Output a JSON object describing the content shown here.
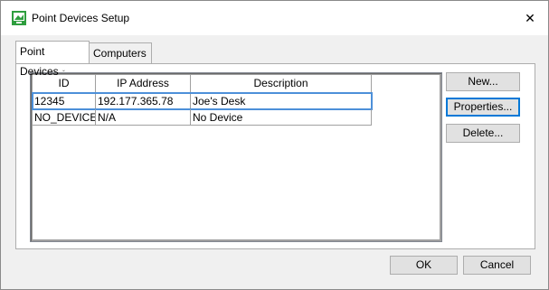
{
  "window": {
    "title": "Point Devices Setup",
    "close_glyph": "✕"
  },
  "tabs": [
    {
      "label": "Point Devices",
      "active": true
    },
    {
      "label": "Computers",
      "active": false
    }
  ],
  "table": {
    "columns": [
      "ID",
      "IP Address",
      "Description"
    ],
    "rows": [
      {
        "id": "12345",
        "ip": "192.177.365.78",
        "description": "Joe's Desk",
        "selected": true
      },
      {
        "id": "NO_DEVICE",
        "ip": "N/A",
        "description": "No Device",
        "selected": false
      }
    ]
  },
  "side_buttons": {
    "new": "New...",
    "properties": "Properties...",
    "delete": "Delete..."
  },
  "footer_buttons": {
    "ok": "OK",
    "cancel": "Cancel"
  },
  "colors": {
    "accent": "#0078d7",
    "selection": "#4d90d9",
    "app_icon": "#2e9e3e"
  }
}
